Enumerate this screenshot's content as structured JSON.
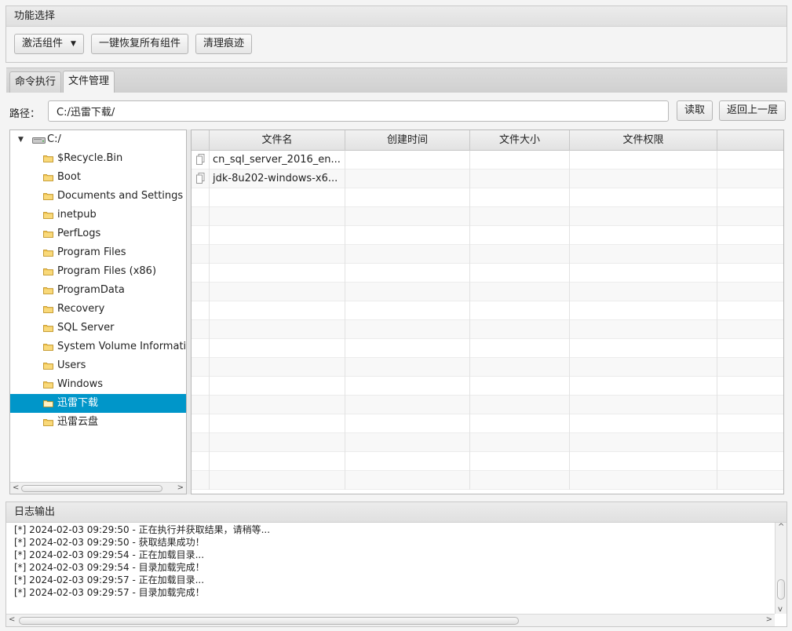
{
  "function_pane": {
    "title": "功能选择",
    "activate_label": "激活组件",
    "restore_label": "一键恢复所有组件",
    "clean_label": "清理痕迹"
  },
  "tabs": [
    {
      "label": "命令执行",
      "selected": false
    },
    {
      "label": "文件管理",
      "selected": true
    }
  ],
  "path": {
    "label": "路径：",
    "value": "C:/迅雷下载/",
    "read_label": "读取",
    "back_label": "返回上一层"
  },
  "tree": {
    "root_label": "C:/",
    "items": [
      {
        "label": "$Recycle.Bin"
      },
      {
        "label": "Boot"
      },
      {
        "label": "Documents and Settings"
      },
      {
        "label": "inetpub"
      },
      {
        "label": "PerfLogs"
      },
      {
        "label": "Program Files"
      },
      {
        "label": "Program Files (x86)"
      },
      {
        "label": "ProgramData"
      },
      {
        "label": "Recovery"
      },
      {
        "label": "SQL Server"
      },
      {
        "label": "System Volume Informati"
      },
      {
        "label": "Users"
      },
      {
        "label": "Windows"
      },
      {
        "label": "迅雷下载"
      },
      {
        "label": "迅雷云盘"
      }
    ],
    "selected_index": 13
  },
  "table": {
    "columns": [
      "文件名",
      "创建时间",
      "文件大小",
      "文件权限"
    ],
    "rows": [
      {
        "name": "cn_sql_server_2016_en...",
        "created": "",
        "size": "",
        "perm": ""
      },
      {
        "name": "jdk-8u202-windows-x6...",
        "created": "",
        "size": "",
        "perm": ""
      }
    ]
  },
  "log": {
    "title": "日志输出",
    "lines": [
      "[*] 2024-02-03 09:29:50 - 正在执行并获取结果，请稍等...",
      "[*] 2024-02-03 09:29:50 - 获取结果成功！",
      "[*] 2024-02-03 09:29:54 - 正在加载目录...",
      "[*] 2024-02-03 09:29:54 - 目录加载完成！",
      "[*] 2024-02-03 09:29:57 - 正在加载目录...",
      "[*] 2024-02-03 09:29:57 - 目录加载完成！"
    ]
  },
  "colors": {
    "selection": "#0096c9",
    "folder": "#f3c24b"
  }
}
